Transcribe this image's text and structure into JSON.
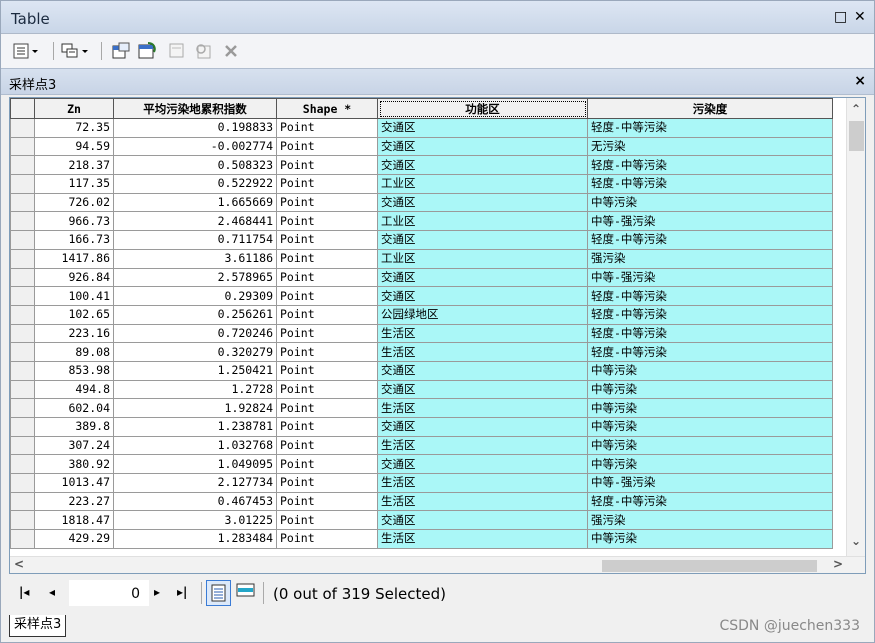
{
  "window": {
    "title": "Table",
    "max_icon": "maximize-icon",
    "close_icon": "close-icon"
  },
  "tab": {
    "title": "采样点3",
    "close": "×"
  },
  "columns": [
    "",
    "Zn",
    "平均污染地累积指数",
    "Shape *",
    "功能区",
    "污染度"
  ],
  "rows": [
    [
      "72.35",
      "0.198833",
      "Point",
      "交通区",
      "轻度-中等污染"
    ],
    [
      "94.59",
      "-0.002774",
      "Point",
      "交通区",
      "无污染"
    ],
    [
      "218.37",
      "0.508323",
      "Point",
      "交通区",
      "轻度-中等污染"
    ],
    [
      "117.35",
      "0.522922",
      "Point",
      "工业区",
      "轻度-中等污染"
    ],
    [
      "726.02",
      "1.665669",
      "Point",
      "交通区",
      "中等污染"
    ],
    [
      "966.73",
      "2.468441",
      "Point",
      "工业区",
      "中等-强污染"
    ],
    [
      "166.73",
      "0.711754",
      "Point",
      "交通区",
      "轻度-中等污染"
    ],
    [
      "1417.86",
      "3.61186",
      "Point",
      "工业区",
      "强污染"
    ],
    [
      "926.84",
      "2.578965",
      "Point",
      "交通区",
      "中等-强污染"
    ],
    [
      "100.41",
      "0.29309",
      "Point",
      "交通区",
      "轻度-中等污染"
    ],
    [
      "102.65",
      "0.256261",
      "Point",
      "公园绿地区",
      "轻度-中等污染"
    ],
    [
      "223.16",
      "0.720246",
      "Point",
      "生活区",
      "轻度-中等污染"
    ],
    [
      "89.08",
      "0.320279",
      "Point",
      "生活区",
      "轻度-中等污染"
    ],
    [
      "853.98",
      "1.250421",
      "Point",
      "交通区",
      "中等污染"
    ],
    [
      "494.8",
      "1.2728",
      "Point",
      "交通区",
      "中等污染"
    ],
    [
      "602.04",
      "1.92824",
      "Point",
      "生活区",
      "中等污染"
    ],
    [
      "389.8",
      "1.238781",
      "Point",
      "交通区",
      "中等污染"
    ],
    [
      "307.24",
      "1.032768",
      "Point",
      "生活区",
      "中等污染"
    ],
    [
      "380.92",
      "1.049095",
      "Point",
      "交通区",
      "中等污染"
    ],
    [
      "1013.47",
      "2.127734",
      "Point",
      "生活区",
      "中等-强污染"
    ],
    [
      "223.27",
      "0.467453",
      "Point",
      "生活区",
      "轻度-中等污染"
    ],
    [
      "1818.47",
      "3.01225",
      "Point",
      "交通区",
      "强污染"
    ],
    [
      "429.29",
      "1.283484",
      "Point",
      "生活区",
      "中等污染"
    ]
  ],
  "nav": {
    "record": "0",
    "status": "(0 out of 319 Selected)"
  },
  "bottom_tab": "采样点3",
  "watermark": "CSDN @juechen333",
  "colors": {
    "cyan": "#aaf7f7"
  }
}
